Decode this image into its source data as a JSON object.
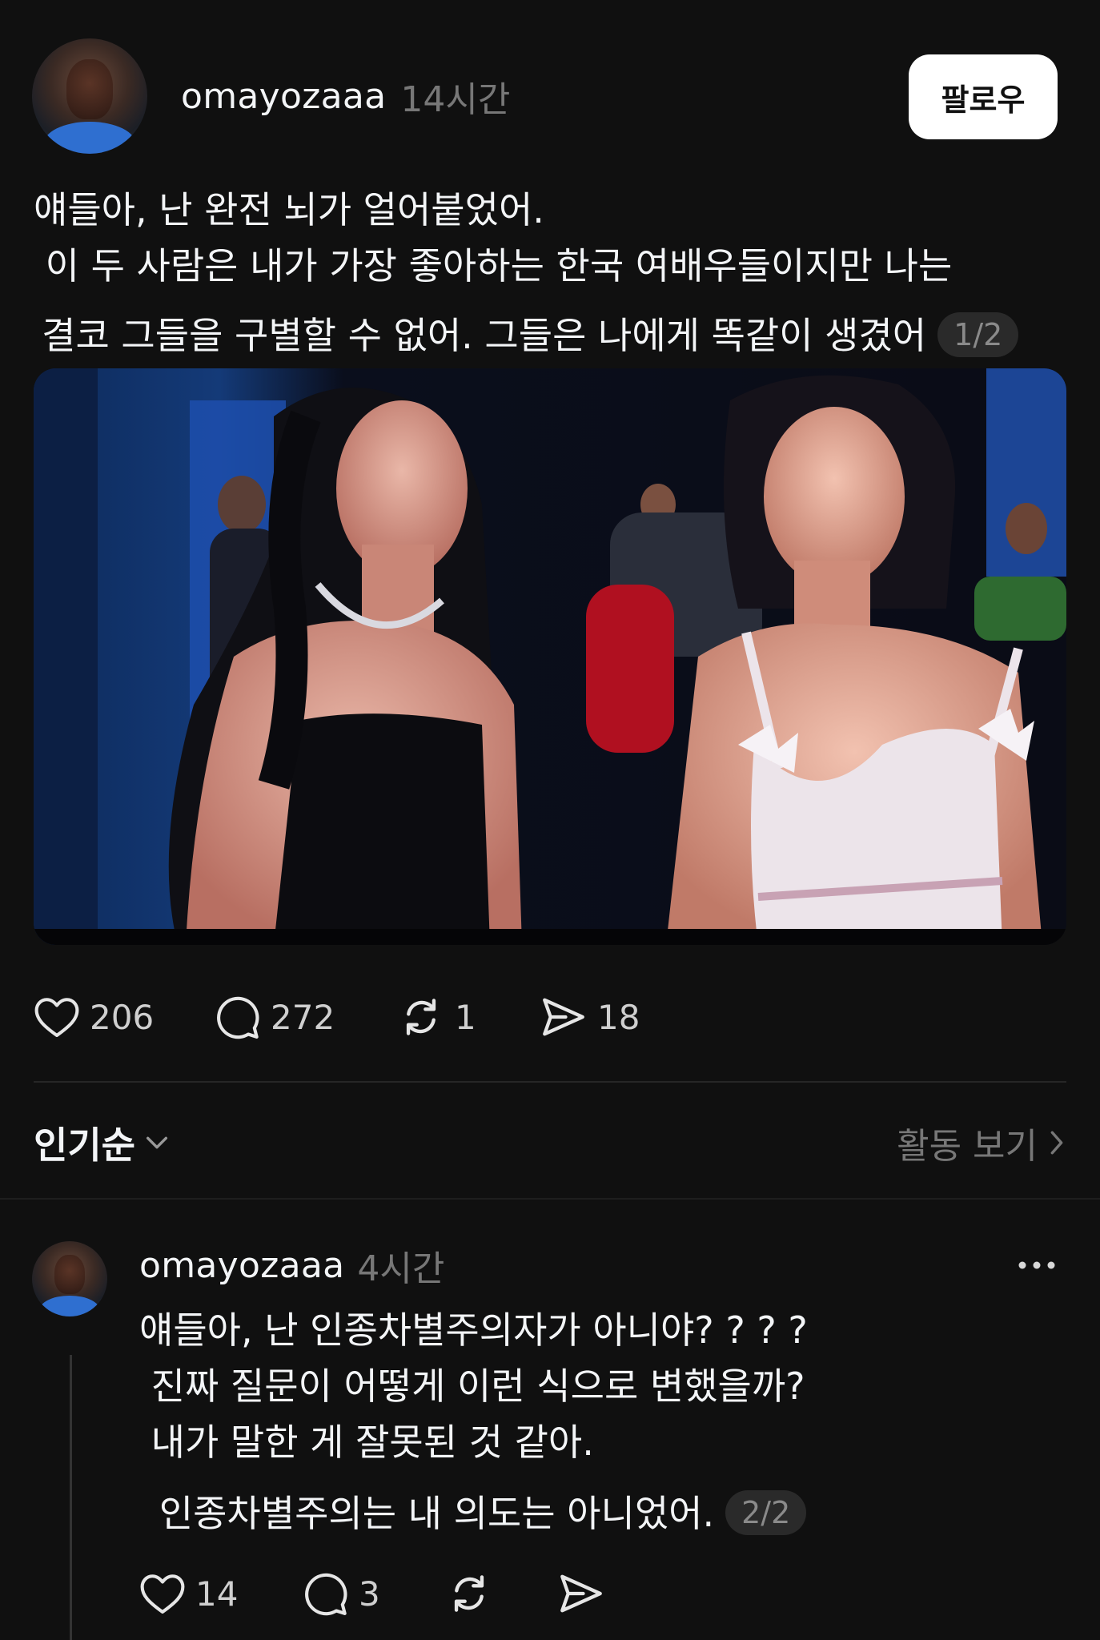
{
  "post": {
    "username": "omayozaaa",
    "time": "14시간",
    "follow_label": "팔로우",
    "lines": [
      "얘들아, 난 완전 뇌가 얼어붙었어.",
      " 이 두 사람은 내가 가장 좋아하는 한국 여배우들이지만 나는",
      "결코 그들을 구별할 수 없어. 그들은 나에게 똑같이 생겼어"
    ],
    "page_indicator": "1/2",
    "likes": "206",
    "comments": "272",
    "reposts": "1",
    "shares": "18"
  },
  "sort": {
    "label": "인기순",
    "activity_label": "활동 보기"
  },
  "reply": {
    "username": "omayozaaa",
    "time": "4시간",
    "more_label": "•••",
    "lines": [
      "얘들아, 난 인종차별주의자가 아니야? ? ? ?",
      " 진짜 질문이 어떻게 이런 식으로 변했을까?",
      " 내가 말한 게 잘못된 것 같아.",
      " 인종차별주의는 내 의도는 아니었어."
    ],
    "page_indicator": "2/2",
    "likes": "14",
    "comments": "3"
  },
  "icons": {
    "like": "heart-icon",
    "comment": "comment-bubble-icon",
    "repost": "repost-icon",
    "share": "send-icon",
    "sort_chevron": "chevron-down-icon",
    "activity_chevron": "chevron-right-icon",
    "more": "more-dots-icon"
  },
  "colors": {
    "background": "#101010",
    "text": "#f3f5f7",
    "muted": "#777777",
    "follow_button": "#ffffff"
  }
}
